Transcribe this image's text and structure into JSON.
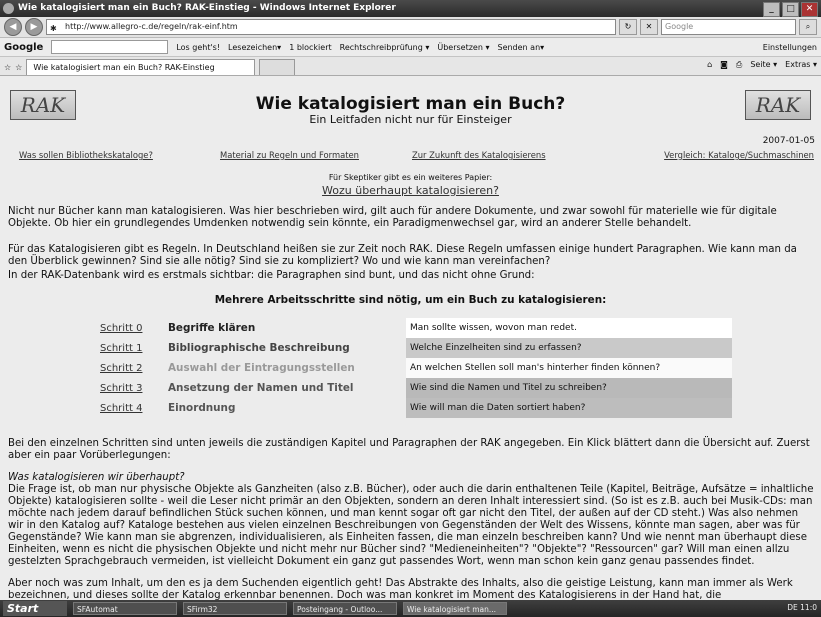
{
  "window": {
    "title": "Wie katalogisiert man ein Buch? RAK-Einstieg - Windows Internet Explorer"
  },
  "address": {
    "url": "http://www.allegro-c.de/regeln/rak-einf.htm",
    "search_placeholder": "Google"
  },
  "toolbar": {
    "logo": "Google",
    "items": [
      "Los geht's!",
      "Lesezeichen▾",
      "1 blockiert",
      "Rechtschreibprüfung ▾",
      "Übersetzen ▾",
      "Senden an▾",
      "Einstellungen"
    ]
  },
  "tabs": {
    "active": "Wie katalogisiert man ein Buch? RAK-Einstieg",
    "right": [
      "Seite ▾",
      "Extras ▾"
    ]
  },
  "page": {
    "logo_text": "RAK",
    "title": "Wie katalogisiert man ein Buch?",
    "subtitle": "Ein Leitfaden nicht nur für Einsteiger",
    "date": "2007-01-05",
    "nav": [
      "Was sollen Bibliothekskataloge?",
      "Material zu Regeln und Formaten",
      "Zur Zukunft des Katalogisierens",
      "Vergleich: Kataloge/Suchmaschinen"
    ],
    "skeptic_note": "Für Skeptiker gibt es ein weiteres Papier:",
    "skeptic_link": "Wozu überhaupt katalogisieren?",
    "p1": "Nicht nur Bücher kann man katalogisieren. Was hier beschrieben wird, gilt auch für andere Dokumente, und zwar sowohl für materielle wie für digitale Objekte. Ob hier ein grundlegendes Umdenken notwendig sein könnte, ein Paradigmenwechsel gar, wird an anderer Stelle behandelt.",
    "p2": "Für das Katalogisieren gibt es Regeln. In Deutschland heißen sie zur Zeit noch RAK. Diese Regeln umfassen einige hundert Paragraphen. Wie kann man da den Überblick gewinnen? Sind sie alle nötig? Sind sie zu kompliziert? Wo und wie kann man vereinfachen?",
    "p3": "In der RAK-Datenbank wird es erstmals sichtbar: die Paragraphen sind bunt, und das nicht ohne Grund:",
    "steps_heading": "Mehrere Arbeitsschritte sind nötig, um ein Buch zu katalogisieren:",
    "steps": [
      {
        "link": "Schritt 0",
        "name": "Begriffe klären",
        "desc": "Man sollte wissen, wovon man redet."
      },
      {
        "link": "Schritt 1",
        "name": "Bibliographische Beschreibung",
        "desc": "Welche Einzelheiten sind zu erfassen?"
      },
      {
        "link": "Schritt 2",
        "name": "Auswahl der Eintragungsstellen",
        "desc": "An welchen Stellen soll man's hinterher finden können?"
      },
      {
        "link": "Schritt 3",
        "name": "Ansetzung der Namen und Titel",
        "desc": "Wie sind die Namen und Titel zu schreiben?"
      },
      {
        "link": "Schritt 4",
        "name": "Einordnung",
        "desc": "Wie will man die Daten sortiert haben?"
      }
    ],
    "p4": "Bei den einzelnen Schritten sind unten jeweils die zuständigen Kapitel und Paragraphen der RAK angegeben. Ein Klick blättert dann die Übersicht auf. Zuerst aber ein paar Vorüberlegungen:",
    "p5_title": "Was katalogisieren wir überhaupt?",
    "p5": "Die Frage ist, ob man nur physische Objekte als Ganzheiten (also z.B. Bücher), oder auch die darin enthaltenen Teile (Kapitel, Beiträge, Aufsätze = inhaltliche Objekte) katalogisieren sollte - weil die Leser nicht primär an den Objekten, sondern an deren Inhalt interessiert sind. (So ist es z.B. auch bei Musik-CDs: man möchte nach jedem darauf befindlichen Stück suchen können, und man kennt sogar oft gar nicht den Titel, der außen auf der CD steht.) Was also nehmen wir in den Katalog auf? Kataloge bestehen aus vielen einzelnen Beschreibungen von Gegenständen der Welt des Wissens, könnte man sagen, aber was für Gegenstände? Wie kann man sie abgrenzen, individualisieren, als Einheiten fassen, die man einzeln beschreiben kann? Und wie nennt man überhaupt diese Einheiten, wenn es nicht die physischen Objekte und nicht mehr nur Bücher sind? \"Medieneinheiten\"? \"Objekte\"? \"Ressourcen\" gar? Will man einen allzu gestelzten Sprachgebrauch vermeiden, ist vielleicht Dokument ein ganz gut passendes Wort, wenn man schon kein ganz genau passendes findet.",
    "p6": "Aber noch was zum Inhalt, um den es ja dem Suchenden eigentlich geht! Das Abstrakte des Inhalts, also die geistige Leistung, kann man immer als Werk bezeichnen, und dieses sollte der Katalog erkennbar benennen. Doch was man konkret im Moment des Katalogisierens in der Hand hat, die"
  },
  "taskbar": {
    "start": "Start",
    "tasks": [
      "SFAutomat",
      "SFirm32",
      "Posteingang - Outloo...",
      "Wie katalogisiert man..."
    ],
    "tray": "DE  11:0"
  }
}
